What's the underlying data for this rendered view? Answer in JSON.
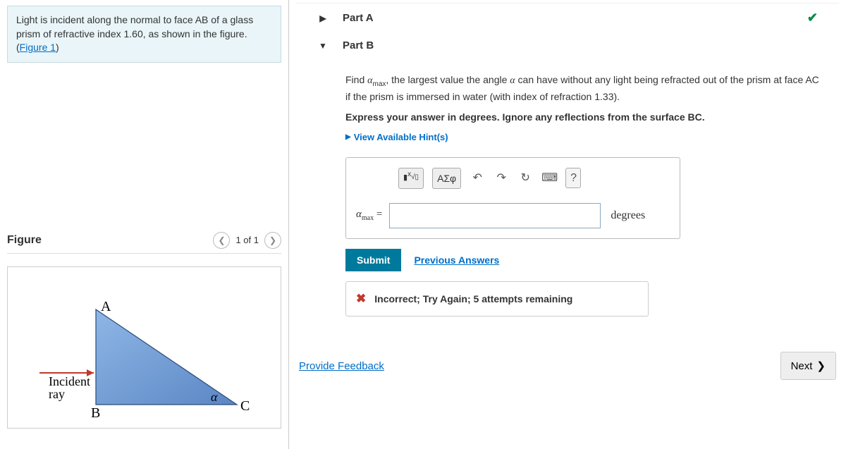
{
  "intro": {
    "text_before": "Light is incident along the normal to face AB of a glass prism of refractive index 1.60, as shown in the figure. (",
    "link": "Figure 1",
    "text_after": ")"
  },
  "figure": {
    "title": "Figure",
    "page": "1 of 1",
    "labels": {
      "A": "A",
      "B": "B",
      "C": "C",
      "alpha": "α",
      "incident": "Incident",
      "ray": "ray"
    }
  },
  "partA": {
    "label": "Part A"
  },
  "partB": {
    "label": "Part B",
    "prompt_prefix": "Find ",
    "var_html": "α",
    "var_sub": "max",
    "prompt_mid": ", the largest value the angle ",
    "var2": "α",
    "prompt_suffix": " can have without any light being refracted out of the prism at face AC if the prism is immersed in water (with index of refraction 1.33).",
    "express": "Express your answer in degrees. Ignore any reflections from the surface BC.",
    "hint": "View Available Hint(s)",
    "toolbar": {
      "template": "▮",
      "greek": "ΑΣφ",
      "help": "?"
    },
    "input_label_var": "α",
    "input_label_sub": "max",
    "input_label_eq": " = ",
    "unit": "degrees",
    "submit": "Submit",
    "prev": "Previous Answers",
    "feedback": "Incorrect; Try Again; 5 attempts remaining"
  },
  "footer": {
    "provide": "Provide Feedback",
    "next": "Next"
  }
}
